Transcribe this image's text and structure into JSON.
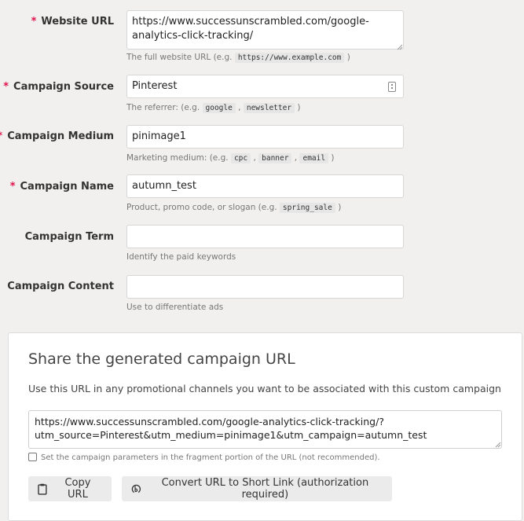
{
  "form": {
    "fields": [
      {
        "label": "Website URL",
        "required": true,
        "value": "https://www.successunscrambled.com/google-analytics-click-tracking/",
        "help_prefix": "The full website URL (e.g. ",
        "help_codes": [
          "https://www.example.com"
        ],
        "help_suffix": ")"
      },
      {
        "label": "Campaign Source",
        "required": true,
        "value": "Pinterest",
        "help_prefix": "The referrer: (e.g. ",
        "help_codes": [
          "google",
          "newsletter"
        ],
        "help_suffix": ")"
      },
      {
        "label": "Campaign Medium",
        "required": true,
        "value": "pinimage1",
        "help_prefix": "Marketing medium: (e.g. ",
        "help_codes": [
          "cpc",
          "banner",
          "email"
        ],
        "help_suffix": ")"
      },
      {
        "label": "Campaign Name",
        "required": true,
        "value": "autumn_test",
        "help_prefix": "Product, promo code, or slogan (e.g. ",
        "help_codes": [
          "spring_sale"
        ],
        "help_suffix": ")"
      },
      {
        "label": "Campaign Term",
        "required": false,
        "value": "",
        "help_prefix": "Identify the paid keywords",
        "help_codes": [],
        "help_suffix": ""
      },
      {
        "label": "Campaign Content",
        "required": false,
        "value": "",
        "help_prefix": "Use to differentiate ads",
        "help_codes": [],
        "help_suffix": ""
      }
    ],
    "required_marker": "*"
  },
  "share": {
    "title": "Share the generated campaign URL",
    "description": "Use this URL in any promotional channels you want to be associated with this custom campaign",
    "generated_url": "https://www.successunscrambled.com/google-analytics-click-tracking/?\nutm_source=Pinterest&utm_medium=pinimage1&utm_campaign=autumn_test",
    "fragment_checkbox": {
      "label": "Set the campaign parameters in the fragment portion of the URL (not recommended).",
      "checked": false
    },
    "copy_button": "Copy URL",
    "shortlink_button": "Convert URL to Short Link (authorization required)"
  },
  "icons": {
    "source_field": "address-book-icon",
    "copy": "clipboard-icon",
    "shortlink": "bitly-icon"
  },
  "colors": {
    "required": "#e0134b",
    "background": "#f1f0ef"
  }
}
